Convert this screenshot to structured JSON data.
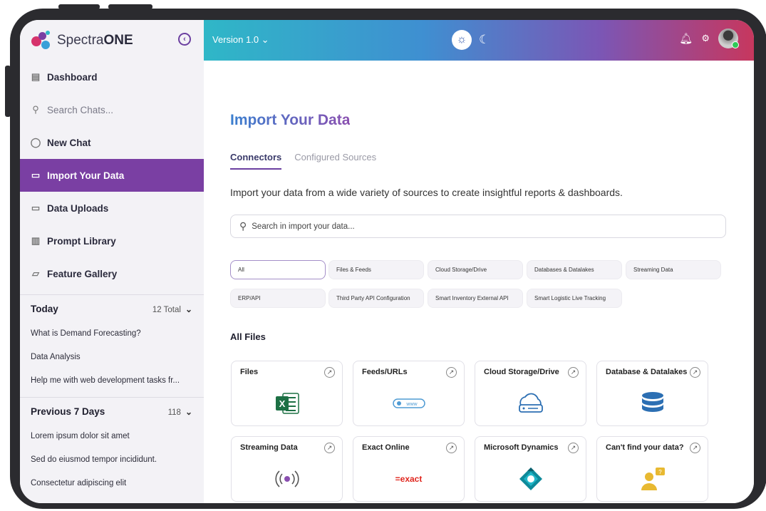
{
  "brand": {
    "name_light": "Spectra",
    "name_bold": "ONE"
  },
  "topbar": {
    "version": "Version 1.0 ⌄"
  },
  "sidebar": {
    "nav": [
      {
        "label": "Dashboard"
      },
      {
        "label": "Search Chats..."
      },
      {
        "label": "New Chat"
      },
      {
        "label": "Import Your Data"
      },
      {
        "label": "Data Uploads"
      },
      {
        "label": "Prompt Library"
      },
      {
        "label": "Feature Gallery"
      }
    ],
    "today": {
      "title": "Today",
      "count": "12 Total",
      "items": [
        "What is Demand Forecasting?",
        "Data Analysis",
        "Help me with web development tasks fr..."
      ]
    },
    "previous": {
      "title": "Previous 7 Days",
      "count": "118",
      "items": [
        "Lorem ipsum dolor sit amet",
        "Sed do eiusmod tempor incididunt.",
        "Consectetur adipiscing elit"
      ]
    }
  },
  "main": {
    "title": "Import Your Data",
    "tabs": [
      "Connectors",
      "Configured Sources"
    ],
    "description": "Import your data from a wide variety of sources to create insightful reports & dashboards.",
    "search_placeholder": "Search in import your data...",
    "filters": [
      "All",
      "Files & Feeds",
      "Cloud Storage/Drive",
      "Databases & Datalakes",
      "Streaming Data",
      "ERP/API",
      "Third Party API Configuration",
      "Smart Inventory External API",
      "Smart Logistic Live Tracking"
    ],
    "section_title": "All Files",
    "cards": [
      {
        "title": "Files",
        "icon": "excel-icon"
      },
      {
        "title": "Feeds/URLs",
        "icon": "www-icon"
      },
      {
        "title": "Cloud Storage/Drive",
        "icon": "cloud-icon"
      },
      {
        "title": "Database & Datalakes",
        "icon": "database-icon"
      },
      {
        "title": "Streaming Data",
        "icon": "broadcast-icon"
      },
      {
        "title": "Exact Online",
        "icon": "exact-logo",
        "logo_text": "=exact"
      },
      {
        "title": "Microsoft Dynamics",
        "icon": "dynamics-logo"
      },
      {
        "title": "Can't find your data?",
        "icon": "user-question-icon"
      }
    ]
  },
  "colors": {
    "accent": "#7a3fa3",
    "gradient_start": "#2fb7c7",
    "gradient_end": "#c7375e"
  }
}
